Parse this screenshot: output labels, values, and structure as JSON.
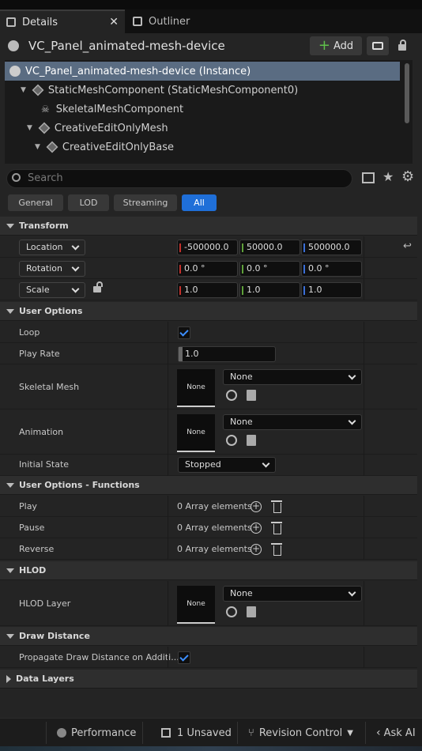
{
  "tabs": {
    "details": "Details",
    "outliner": "Outliner"
  },
  "header": {
    "title": "VC_Panel_animated-mesh-device",
    "add_label": "Add"
  },
  "tree": [
    {
      "label": "VC_Panel_animated-mesh-device (Instance)"
    },
    {
      "label": "StaticMeshComponent (StaticMeshComponent0)"
    },
    {
      "label": "SkeletalMeshComponent"
    },
    {
      "label": "CreativeEditOnlyMesh"
    },
    {
      "label": "CreativeEditOnlyBase"
    }
  ],
  "search": {
    "placeholder": "Search"
  },
  "filters": [
    "General",
    "LOD",
    "Streaming",
    "All"
  ],
  "transform": {
    "section": "Transform",
    "location": {
      "label": "Location",
      "x": "-500000.0",
      "y": "50000.0",
      "z": "500000.0"
    },
    "rotation": {
      "label": "Rotation",
      "x": "0.0 °",
      "y": "0.0 °",
      "z": "0.0 °"
    },
    "scale": {
      "label": "Scale",
      "x": "1.0",
      "y": "1.0",
      "z": "1.0"
    }
  },
  "user_options": {
    "section": "User Options",
    "loop": "Loop",
    "play_rate": {
      "label": "Play Rate",
      "value": "1.0"
    },
    "skeletal_mesh": {
      "label": "Skeletal Mesh",
      "value": "None",
      "thumb": "None"
    },
    "animation": {
      "label": "Animation",
      "value": "None",
      "thumb": "None"
    },
    "initial_state": {
      "label": "Initial State",
      "value": "Stopped"
    }
  },
  "functions": {
    "section": "User Options - Functions",
    "rows": [
      {
        "label": "Play",
        "value": "0 Array elements"
      },
      {
        "label": "Pause",
        "value": "0 Array elements"
      },
      {
        "label": "Reverse",
        "value": "0 Array elements"
      }
    ]
  },
  "hlod": {
    "section": "HLOD",
    "label": "HLOD Layer",
    "value": "None",
    "thumb": "None"
  },
  "draw_distance": {
    "section": "Draw Distance",
    "label": "Propagate Draw Distance on Additi..."
  },
  "data_layers": {
    "section": "Data Layers"
  },
  "status": {
    "performance": "Performance",
    "unsaved": "1 Unsaved",
    "revision": "Revision Control",
    "ask_ai": "Ask AI"
  },
  "colors": {
    "accent": "#1f6fd8",
    "x_axis": "#c4302b",
    "y_axis": "#5fa03a",
    "z_axis": "#3a6fd8"
  }
}
